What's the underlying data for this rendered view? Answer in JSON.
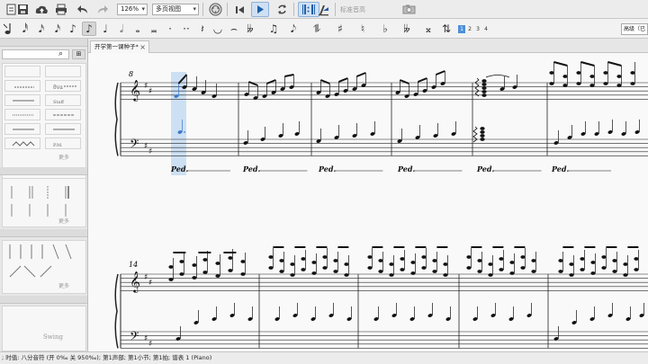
{
  "toolbar": {
    "zoom_value": "126%",
    "view_mode": "多页视图",
    "input_method": "标准音高"
  },
  "note_input": {
    "voices": [
      "1",
      "2",
      "3",
      "4"
    ],
    "active_voice": "1",
    "mode_label": "高级（已"
  },
  "palette": {
    "section_texts": [
      "更多",
      "更多",
      "更多"
    ],
    "tempo_marks": [
      "Swing"
    ]
  },
  "document": {
    "tab_title": "开学第一课种子*"
  },
  "score": {
    "system1_measure_number": "8",
    "system2_measure_number": "14",
    "pedal_marking": "Ped.",
    "key_signature": "D major"
  },
  "status": {
    "text": "; 时值: 八分音符 (开 0‰ 关 950‰); 第1声部; 第1小节; 第1拍; 谱表 1 (Piano)"
  },
  "colors": {
    "selection": "#4a90d9",
    "selection_highlight": "#c5dcf2",
    "canvas": "#f9f9f9"
  }
}
